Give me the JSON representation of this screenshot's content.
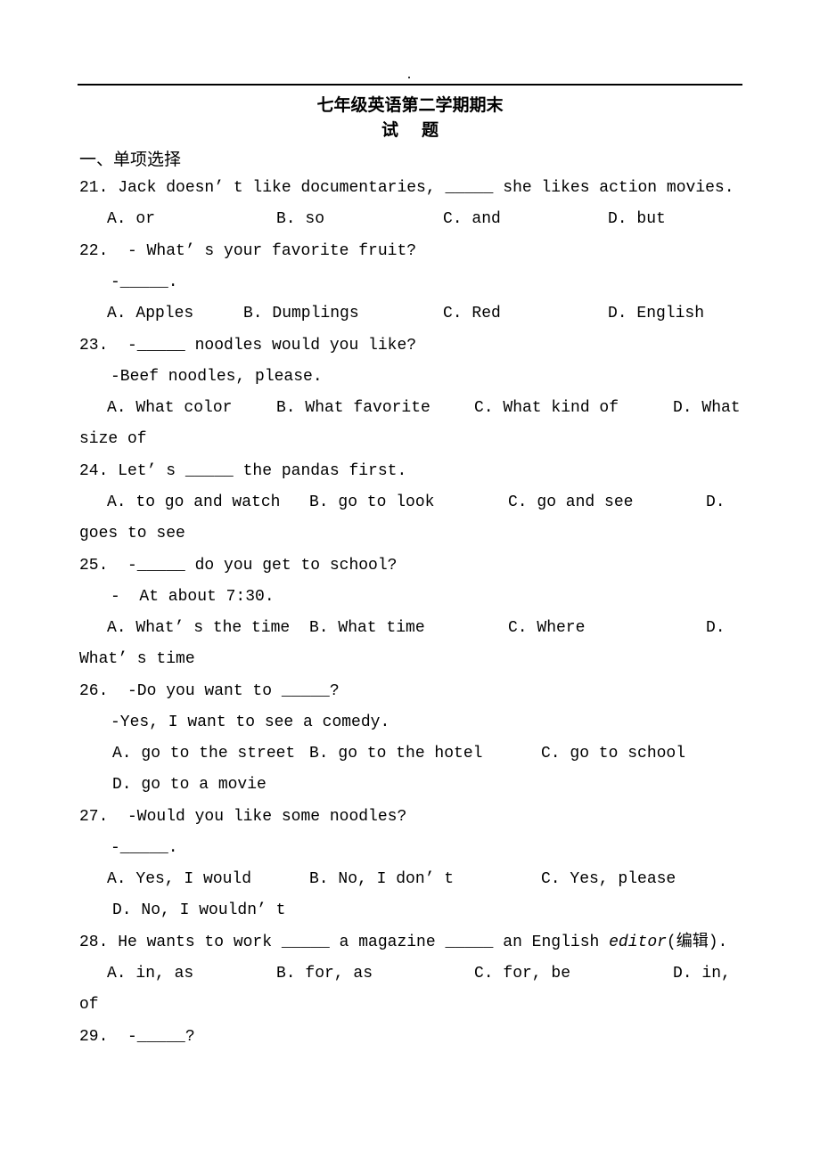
{
  "header": {
    "dot": "."
  },
  "title": {
    "line1": "七年级英语第二学期期末",
    "line2": "试题"
  },
  "section": {
    "label": "一、单项选择"
  },
  "questions": {
    "q21": {
      "stem": "21. Jack doesn’ t like documentaries, _____ she likes action movies.",
      "A": "A. or",
      "B": "B. so",
      "C": "C. and",
      "D": "D. but"
    },
    "q22": {
      "stem": "22.  - What’ s your favorite fruit?",
      "reply": "-_____.",
      "A": "A. Apples",
      "B": "B. Dumplings",
      "C": "C. Red",
      "D": "D. English"
    },
    "q23": {
      "stem": "23.  -_____ noodles would you like?",
      "reply": "-Beef noodles, please.",
      "A": "A. What color",
      "B": "B. What favorite",
      "C": "C. What kind of",
      "D": "D. What",
      "wrap": "size of"
    },
    "q24": {
      "stem": "24. Let’ s _____ the pandas first.",
      "A": "A. to go and watch",
      "B": "B. go to look",
      "C": "C. go and see",
      "D": "D.",
      "wrap": "goes to see"
    },
    "q25": {
      "stem": "25.  -_____ do you get to school?",
      "reply": "-  At about 7:30.",
      "A": "A. What’ s the time",
      "B": "B. What time",
      "C": "C. Where",
      "D": "D.",
      "wrap": "What’ s time"
    },
    "q26": {
      "stem": "26.  -Do you want to _____?",
      "reply": "-Yes, I want to see a comedy.",
      "A": "A. go to the street",
      "B": "B. go to the hotel",
      "C": "C. go to school",
      "D": "D. go to a movie"
    },
    "q27": {
      "stem": "27.  -Would you like some noodles?",
      "reply": "-_____.",
      "A": "A. Yes, I would",
      "B": "B. No, I don’ t",
      "C": "C. Yes, please",
      "D": "D. No, I wouldn’ t"
    },
    "q28": {
      "stem_pre": "28. He wants to work _____ a magazine _____ an English ",
      "stem_italic": "editor",
      "stem_post": "(编辑).",
      "A": "A. in, as",
      "B": "B. for, as",
      "C": "C. for, be",
      "D": "D. in,",
      "wrap": "of"
    },
    "q29": {
      "stem": "29.  -_____?"
    }
  }
}
